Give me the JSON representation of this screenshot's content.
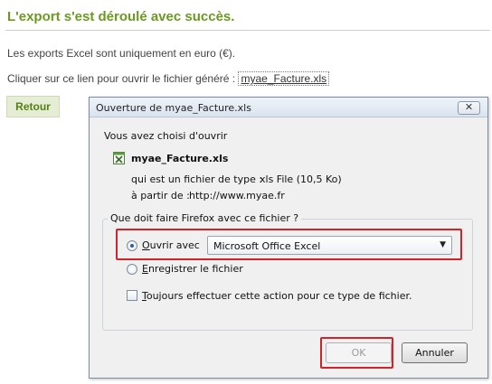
{
  "page": {
    "title": "L'export s'est déroulé avec succès.",
    "line1": "Les exports Excel sont uniquement en euro (€).",
    "line2_prefix": "Cliquer sur ce lien pour ouvrir le fichier généré :",
    "file_link": "myae_Facture.xls",
    "retour_label": "Retour",
    "accent_color": "#6a9a1f"
  },
  "dialog": {
    "title": "Ouverture de myae_Facture.xls",
    "close_glyph": "✕",
    "intro": "Vous avez choisi d'ouvrir",
    "file_name": "myae_Facture.xls",
    "file_icon": "excel-file-icon",
    "type_label": "qui est un fichier de type :",
    "type_value": "xls File (10,5 Ko)",
    "from_label": "à partir de :",
    "from_value": "http://www.myae.fr",
    "question": "Que doit faire Firefox avec ce fichier ?",
    "open_with_accel": "O",
    "open_with_rest": "uvrir avec",
    "open_with_app": "Microsoft Office Excel",
    "save_accel": "E",
    "save_rest": "nregistrer le fichier",
    "always_accel": "T",
    "always_rest": "oujours effectuer cette action pour ce type de fichier.",
    "ok_label": "OK",
    "cancel_label": "Annuler",
    "selected_option": "open_with",
    "always_checked": false,
    "highlight_color": "#d3232a"
  }
}
